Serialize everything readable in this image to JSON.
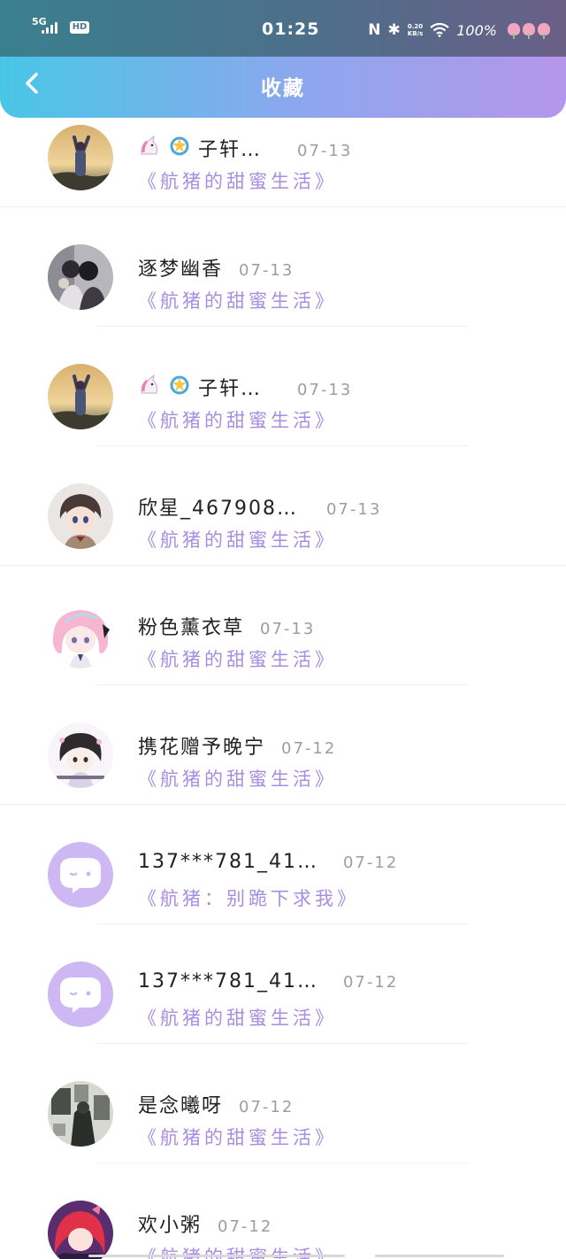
{
  "status_bar": {
    "network": "5G",
    "hd": "HD",
    "time": "01:25",
    "speed_value": "0.20",
    "speed_unit": "KB/s",
    "battery": "100%"
  },
  "header": {
    "title": "收藏",
    "back_icon": "chevron-left-icon"
  },
  "colors": {
    "header_gradient": [
      "#49c6e6",
      "#b596ea"
    ],
    "book_title": "#a78ee0",
    "date": "#9c9ca4",
    "nickname": "#222222"
  },
  "favorites": [
    {
      "nickname": "子轩…",
      "date": "07-13",
      "book": "《航猪的甜蜜生活》",
      "avatar": "sunset-photo",
      "emoji_prefix": true
    },
    {
      "nickname": "逐梦幽香",
      "date": "07-13",
      "book": "《航猪的甜蜜生活》",
      "avatar": "couple-photo",
      "emoji_prefix": false
    },
    {
      "nickname": "子轩…",
      "date": "07-13",
      "book": "《航猪的甜蜜生活》",
      "avatar": "sunset-photo",
      "emoji_prefix": true
    },
    {
      "nickname": "欣星_467908…",
      "date": "07-13",
      "book": "《航猪的甜蜜生活》",
      "avatar": "anime-boy",
      "emoji_prefix": false
    },
    {
      "nickname": "粉色薰衣草",
      "date": "07-13",
      "book": "《航猪的甜蜜生活》",
      "avatar": "anime-pink-hair",
      "emoji_prefix": false
    },
    {
      "nickname": "携花赠予晚宁",
      "date": "07-12",
      "book": "《航猪的甜蜜生活》",
      "avatar": "anime-chibi",
      "emoji_prefix": false
    },
    {
      "nickname": "137***781_41…",
      "date": "07-12",
      "book": "《航猪：别跪下求我》",
      "avatar": "default-chat",
      "emoji_prefix": false
    },
    {
      "nickname": "137***781_41…",
      "date": "07-12",
      "book": "《航猪的甜蜜生活》",
      "avatar": "default-chat",
      "emoji_prefix": false
    },
    {
      "nickname": "是念曦呀",
      "date": "07-12",
      "book": "《航猪的甜蜜生活》",
      "avatar": "dark-photo",
      "emoji_prefix": false
    },
    {
      "nickname": "欢小粥",
      "date": "07-12",
      "book": "《航猪的甜蜜生活》",
      "avatar": "anime-red-hair",
      "emoji_prefix": false
    }
  ]
}
